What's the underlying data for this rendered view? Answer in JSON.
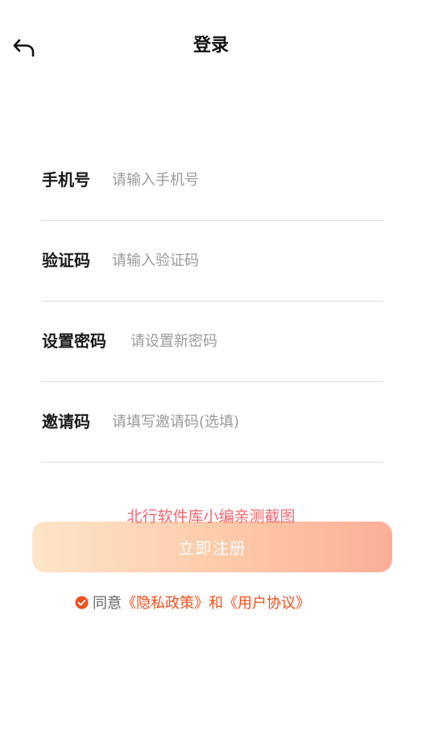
{
  "header": {
    "title": "登录",
    "back_icon": "back-arrow-icon"
  },
  "form": {
    "fields": [
      {
        "label": "手机号",
        "placeholder": "请输入手机号",
        "value": ""
      },
      {
        "label": "验证码",
        "placeholder": "请输入验证码",
        "value": ""
      },
      {
        "label": "设置密码",
        "placeholder": "请设置新密码",
        "value": ""
      },
      {
        "label": "邀请码",
        "placeholder": "请填写邀请码(选填)",
        "value": ""
      }
    ]
  },
  "watermark": "北行软件库小编亲测截图",
  "register_button": {
    "label": "立即注册",
    "gradient_colors": [
      "#fde5c8",
      "#fcae98"
    ]
  },
  "agreement": {
    "checked": true,
    "check_icon": "check-circle-icon",
    "prefix": "同意",
    "privacy_link": "《隐私政策》",
    "conjunction": "和",
    "user_link": "《用户协议》"
  },
  "colors": {
    "accent": "#f0501e",
    "placeholder": "#9a9a9a",
    "divider": "#dcdcdc"
  }
}
